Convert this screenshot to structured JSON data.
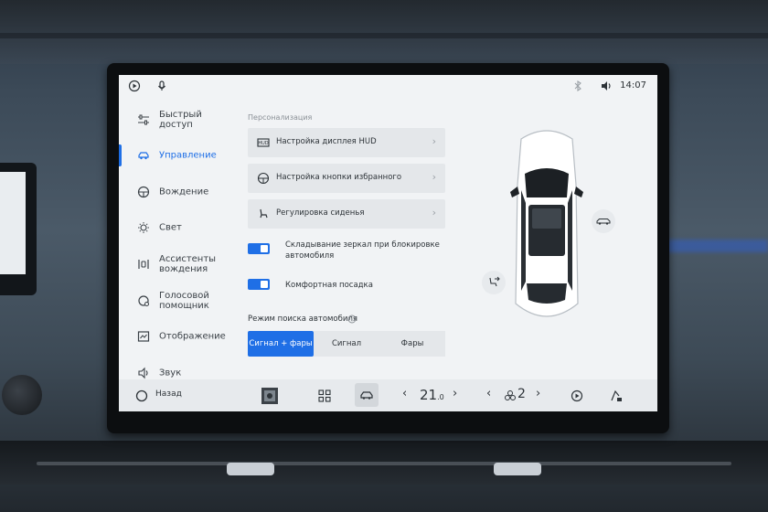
{
  "status": {
    "time": "14:07"
  },
  "sidebar": {
    "items": [
      {
        "label": "Быстрый доступ",
        "icon": "sliders-icon"
      },
      {
        "label": "Управление",
        "icon": "car-icon"
      },
      {
        "label": "Вождение",
        "icon": "steering-wheel-icon"
      },
      {
        "label": "Свет",
        "icon": "light-icon"
      },
      {
        "label": "Ассистенты вождения",
        "icon": "assist-icon"
      },
      {
        "label": "Голосовой помощник",
        "icon": "voice-icon"
      },
      {
        "label": "Отображение",
        "icon": "display-icon"
      },
      {
        "label": "Звук",
        "icon": "speaker-icon"
      }
    ]
  },
  "content": {
    "section_title": "Персонализация",
    "rows": [
      {
        "label": "Настройка дисплея HUD",
        "icon": "hud-icon"
      },
      {
        "label": "Настройка кнопки избранного",
        "icon": "steering-wheel-icon"
      },
      {
        "label": "Регулировка сиденья",
        "icon": "seat-icon"
      }
    ],
    "toggles": [
      {
        "label": "Складывание зеркал при блокировке автомобиля",
        "on": true
      },
      {
        "label": "Комфортная посадка",
        "on": true
      }
    ],
    "search_title": "Режим поиска автомобиля",
    "search_options": [
      "Сигнал + фары",
      "Сигнал",
      "Фары"
    ],
    "search_selected": "Сигнал + фары"
  },
  "bottom": {
    "back_label": "Назад",
    "temp_int": "21",
    "temp_dec": ".0",
    "fan_level": "2"
  },
  "colors": {
    "accent": "#1f6fe6",
    "screen_bg": "#f1f3f5"
  }
}
